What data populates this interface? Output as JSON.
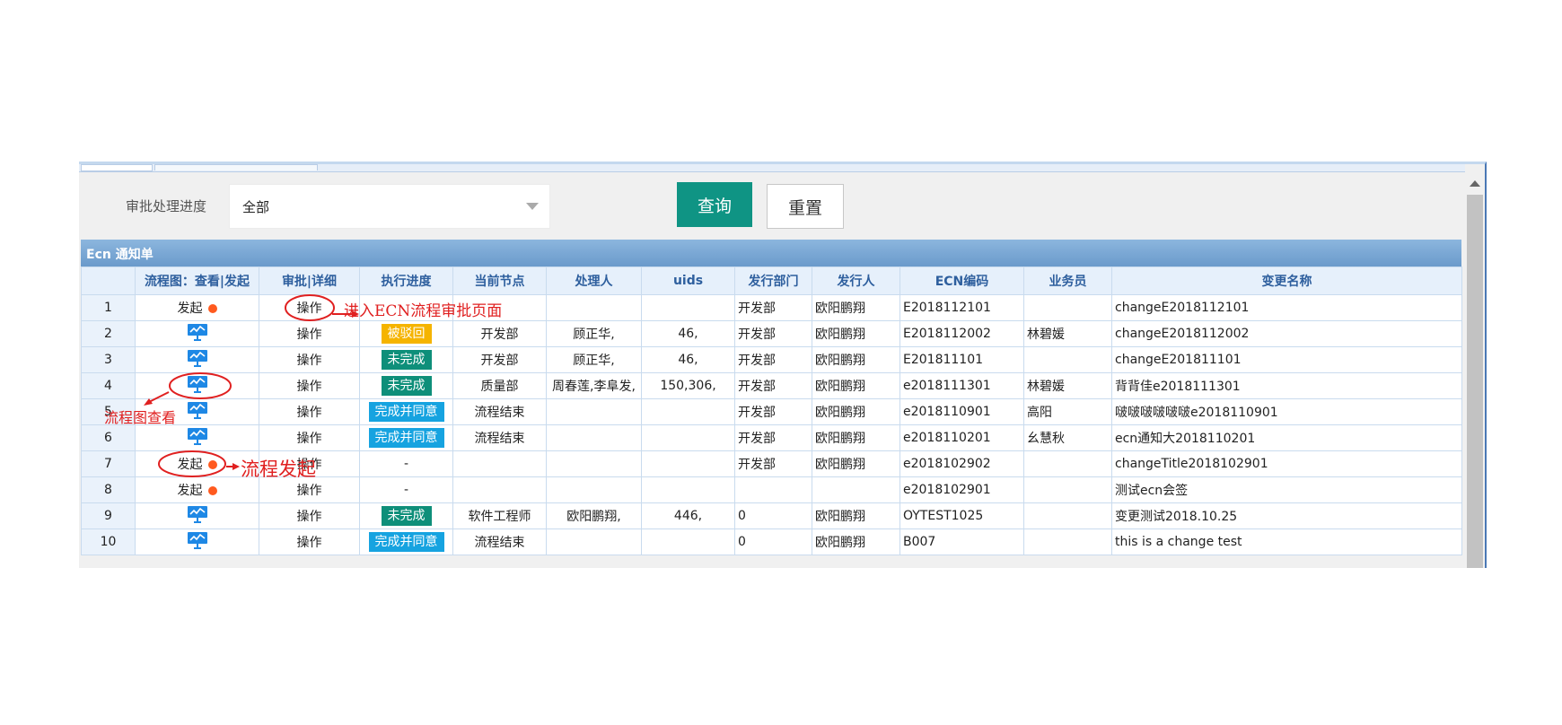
{
  "filter": {
    "label": "审批处理进度",
    "value": "全部"
  },
  "buttons": {
    "query": "查询",
    "reset": "重置"
  },
  "panel": {
    "title": "Ecn 通知单"
  },
  "columns": [
    "",
    "流程图：查看|发起",
    "审批|详细",
    "执行进度",
    "当前节点",
    "处理人",
    "uids",
    "发行部门",
    "发行人",
    "ECN编码",
    "业务员",
    "变更名称"
  ],
  "rows": [
    {
      "no": "1",
      "flow": "发起",
      "op": "操作",
      "status": "",
      "status_type": "",
      "node": "",
      "handler": "",
      "uids": "",
      "dept": "开发部",
      "issuer": "欧阳鹏翔",
      "ecn": "E2018112101",
      "sales": "",
      "name": "changeE2018112101"
    },
    {
      "no": "2",
      "flow": "icon",
      "op": "操作",
      "status": "被驳回",
      "status_type": "rej",
      "node": "开发部",
      "handler": "顾正华,",
      "uids": "46,",
      "dept": "开发部",
      "issuer": "欧阳鹏翔",
      "ecn": "E2018112002",
      "sales": "林碧媛",
      "name": "changeE2018112002"
    },
    {
      "no": "3",
      "flow": "icon",
      "op": "操作",
      "status": "未完成",
      "status_type": "inc",
      "node": "开发部",
      "handler": "顾正华,",
      "uids": "46,",
      "dept": "开发部",
      "issuer": "欧阳鹏翔",
      "ecn": "E201811101",
      "sales": "",
      "name": "changeE201811101"
    },
    {
      "no": "4",
      "flow": "icon",
      "op": "操作",
      "status": "未完成",
      "status_type": "inc",
      "node": "质量部",
      "handler": "周春莲,李阜发,",
      "uids": "150,306,",
      "dept": "开发部",
      "issuer": "欧阳鹏翔",
      "ecn": "e2018111301",
      "sales": "林碧媛",
      "name": "背背佳e2018111301"
    },
    {
      "no": "5",
      "flow": "icon",
      "op": "操作",
      "status": "完成并同意",
      "status_type": "done",
      "node": "流程结束",
      "handler": "",
      "uids": "",
      "dept": "开发部",
      "issuer": "欧阳鹏翔",
      "ecn": "e2018110901",
      "sales": "高阳",
      "name": "啵啵啵啵啵啵e2018110901"
    },
    {
      "no": "6",
      "flow": "icon",
      "op": "操作",
      "status": "完成并同意",
      "status_type": "done",
      "node": "流程结束",
      "handler": "",
      "uids": "",
      "dept": "开发部",
      "issuer": "欧阳鹏翔",
      "ecn": "e2018110201",
      "sales": "幺慧秋",
      "name": "ecn通知大2018110201"
    },
    {
      "no": "7",
      "flow": "发起",
      "op": "操作",
      "status": "-",
      "status_type": "",
      "node": "",
      "handler": "",
      "uids": "",
      "dept": "开发部",
      "issuer": "欧阳鹏翔",
      "ecn": "e2018102902",
      "sales": "",
      "name": "changeTitle2018102901"
    },
    {
      "no": "8",
      "flow": "发起",
      "op": "操作",
      "status": "-",
      "status_type": "",
      "node": "",
      "handler": "",
      "uids": "",
      "dept": "",
      "issuer": "",
      "ecn": "e2018102901",
      "sales": "",
      "name": "测试ecn会签"
    },
    {
      "no": "9",
      "flow": "icon",
      "op": "操作",
      "status": "未完成",
      "status_type": "inc",
      "node": "软件工程师",
      "handler": "欧阳鹏翔,",
      "uids": "446,",
      "dept": "0",
      "issuer": "欧阳鹏翔",
      "ecn": "OYTEST1025",
      "sales": "",
      "name": "变更测试2018.10.25"
    },
    {
      "no": "10",
      "flow": "icon",
      "op": "操作",
      "status": "完成并同意",
      "status_type": "done",
      "node": "流程结束",
      "handler": "",
      "uids": "",
      "dept": "0",
      "issuer": "欧阳鹏翔",
      "ecn": "B007",
      "sales": "",
      "name": "this is a change test"
    }
  ],
  "annotations": {
    "op_note": "进入ECN流程审批页面",
    "flow_note": "流程图查看",
    "start_note": "流程发起"
  },
  "colors": {
    "accent": "#0f9484",
    "rejected": "#f5b400",
    "incomplete": "#0e8f7a",
    "done": "#16a3e0",
    "annotation": "#e02020"
  }
}
